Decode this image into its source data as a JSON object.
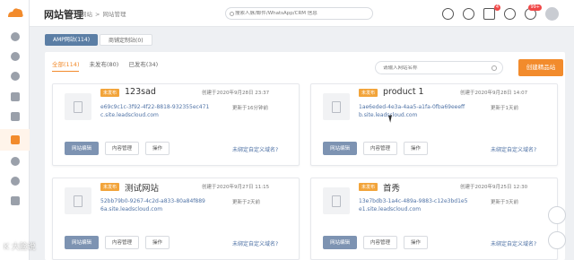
{
  "header": {
    "title": "网站管理",
    "breadcrumb": [
      "网站",
      ">",
      "网站管理"
    ],
    "search_placeholder": "搜索人脉/邮件/WhatsApp/CRM 信息",
    "message_badge": "4",
    "avatar_badge": "99+"
  },
  "tabs": [
    {
      "label": "AMP网站(114)",
      "active": true
    },
    {
      "label": "商铺定制站(0)",
      "active": false
    }
  ],
  "filters": [
    {
      "label": "全部(114)",
      "active": true
    },
    {
      "label": "未发布(80)",
      "active": false
    },
    {
      "label": "已发布(34)",
      "active": false
    }
  ],
  "site_search_placeholder": "请输入网站名称",
  "create_button": "创建精品站",
  "cards": [
    {
      "status": "未发布",
      "name": "123sad",
      "created": "创建于2020年9月28日 23:37",
      "code": "e69c9c1c-3f92-4f22-8818-932355ec471",
      "updated": "更新于16分钟前",
      "url": "c.site.leadscloud.com",
      "edit": "网站编辑",
      "content": "内容管理",
      "ops": "操作",
      "bind": "未绑定自定义域名?"
    },
    {
      "status": "未发布",
      "name": "product 1",
      "created": "创建于2020年9月28日 14:07",
      "code": "1ae6eded-4e3a-4aa5-a1fa-0fba69eeeff",
      "updated": "更新于1天前",
      "url": "b.site.leadscloud.com",
      "edit": "网站编辑",
      "content": "内容管理",
      "ops": "操作",
      "bind": "未绑定自定义域名?"
    },
    {
      "status": "未发布",
      "name": "测试网站",
      "created": "创建于2020年9月27日 11:15",
      "code": "52bb79b0-9267-4c2d-a833-80a84f889",
      "updated": "更新于2天前",
      "url": "6a.site.leadscloud.com",
      "edit": "网站编辑",
      "content": "内容管理",
      "ops": "操作",
      "bind": "未绑定自定义域名?"
    },
    {
      "status": "未发布",
      "name": "首秀",
      "created": "创建于2020年9月25日 12:30",
      "code": "13e7bdb3-1a4c-489a-9883-c12e3bd1e5",
      "updated": "更新于3天前",
      "url": "e1.site.leadscloud.com",
      "edit": "网站编辑",
      "content": "内容管理",
      "ops": "操作",
      "bind": "未绑定自定义域名?"
    }
  ],
  "watermark": "K 大脸说",
  "accent_color": "#f28b2c",
  "link_color": "#5073a6"
}
